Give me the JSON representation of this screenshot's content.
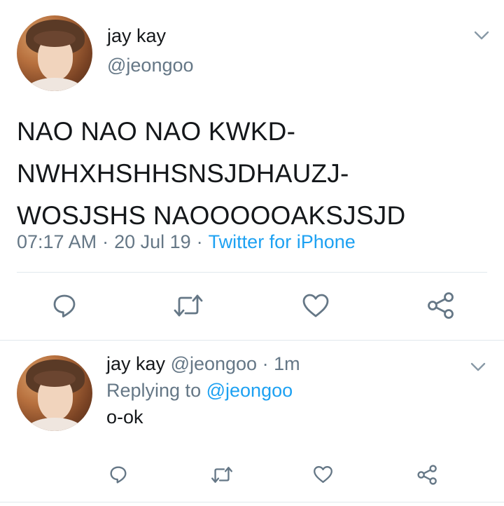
{
  "main_tweet": {
    "author_name": "jay kay",
    "author_handle": "@jeongoo",
    "text_lines": [
      "NAO NAO NAO KWKD-",
      "NWHXHSHHSNSJDHAUZJ-",
      "WOSJSHS NAOOOOOAKSJSJD"
    ],
    "time": "07:17 AM",
    "date": "20 Jul 19",
    "separator": "·",
    "source": "Twitter for iPhone",
    "icons": [
      "reply-icon",
      "retweet-icon",
      "like-icon",
      "share-icon",
      "chevron-down-icon"
    ]
  },
  "reply_tweet": {
    "author_name": "jay kay",
    "author_handle": "@jeongoo",
    "separator": "·",
    "time_ago": "1m",
    "replying_prefix": "Replying to",
    "replying_mention": "@jeongoo",
    "text": "o-ok",
    "icons": [
      "reply-icon",
      "retweet-icon",
      "like-icon",
      "share-icon",
      "chevron-down-icon"
    ]
  },
  "colors": {
    "text": "#14171a",
    "secondary": "#657786",
    "link": "#1da1f2",
    "divider": "#e1e8ed",
    "icon": "#657786"
  }
}
